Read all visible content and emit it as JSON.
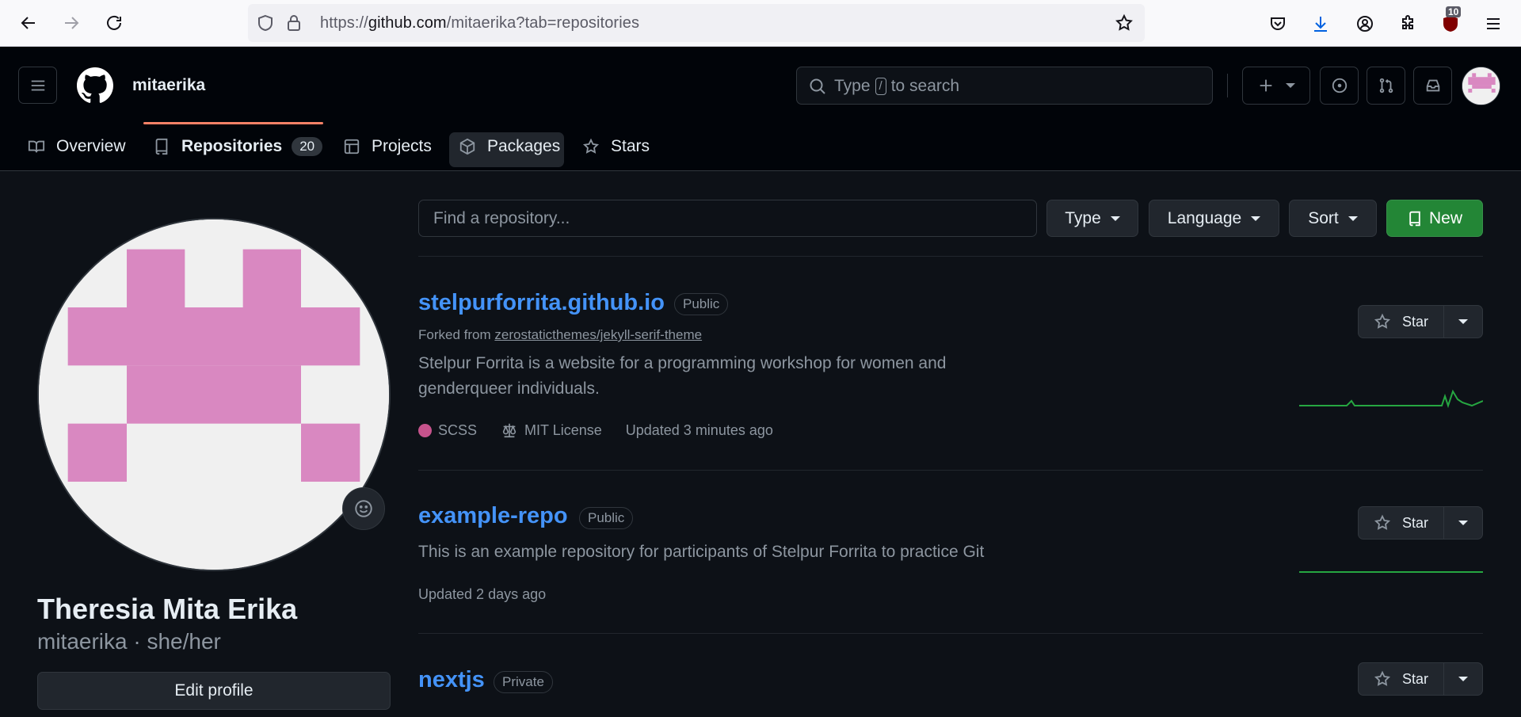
{
  "browser": {
    "url_prefix": "https://",
    "url_host": "github.com",
    "url_path": "/mitaerika?tab=repositories",
    "extension_badge": "10"
  },
  "header": {
    "username": "mitaerika",
    "search_placeholder_before": "Type",
    "search_key": "/",
    "search_placeholder_after": "to search"
  },
  "tabs": [
    {
      "label": "Overview"
    },
    {
      "label": "Repositories",
      "count": "20"
    },
    {
      "label": "Projects"
    },
    {
      "label": "Packages"
    },
    {
      "label": "Stars"
    }
  ],
  "profile": {
    "full_name": "Theresia Mita Erika",
    "subtitle": "mitaerika · she/her",
    "edit_label": "Edit profile"
  },
  "filters": {
    "search_placeholder": "Find a repository...",
    "type_label": "Type",
    "language_label": "Language",
    "sort_label": "Sort",
    "new_label": "New"
  },
  "repos": [
    {
      "name": "stelpurforrita.github.io",
      "visibility": "Public",
      "fork_prefix": "Forked from",
      "fork_source": "zerostaticthemes/jekyll-serif-theme",
      "description": "Stelpur Forrita is a website for a programming workshop for women and genderqueer individuals.",
      "language": "SCSS",
      "language_color": "#c6538c",
      "license": "MIT License",
      "updated": "Updated 3 minutes ago",
      "star_label": "Star"
    },
    {
      "name": "example-repo",
      "visibility": "Public",
      "description": "This is an example repository for participants of Stelpur Forrita to practice Git",
      "updated": "Updated 2 days ago",
      "star_label": "Star"
    },
    {
      "name": "nextjs",
      "visibility": "Private",
      "star_label": "Star"
    }
  ],
  "colors": {
    "accent_link": "#4493f8",
    "new_button": "#238636",
    "tab_underline": "#f78166",
    "avatar_pink": "#d988c1"
  }
}
